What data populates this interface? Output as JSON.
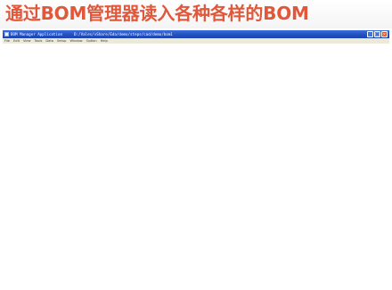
{
  "slide": {
    "title": "通过BOM管理器读入各种各样的BOM"
  },
  "window": {
    "app_title": "BOM Manager Application",
    "path": "D:/Vales/vShare/Eda/demo/steps/cad/demo/bom1",
    "buttons": {
      "minimize": "_",
      "maximize": "□",
      "close": "×"
    }
  },
  "menu": {
    "items": [
      "File",
      "Edit",
      "View",
      "Tools",
      "Data",
      "Setup",
      "Window",
      "Option",
      "Help"
    ]
  },
  "colors": {
    "title": "#e0573a",
    "titlebar": "#2450c2",
    "menubar": "#ece9d8"
  }
}
